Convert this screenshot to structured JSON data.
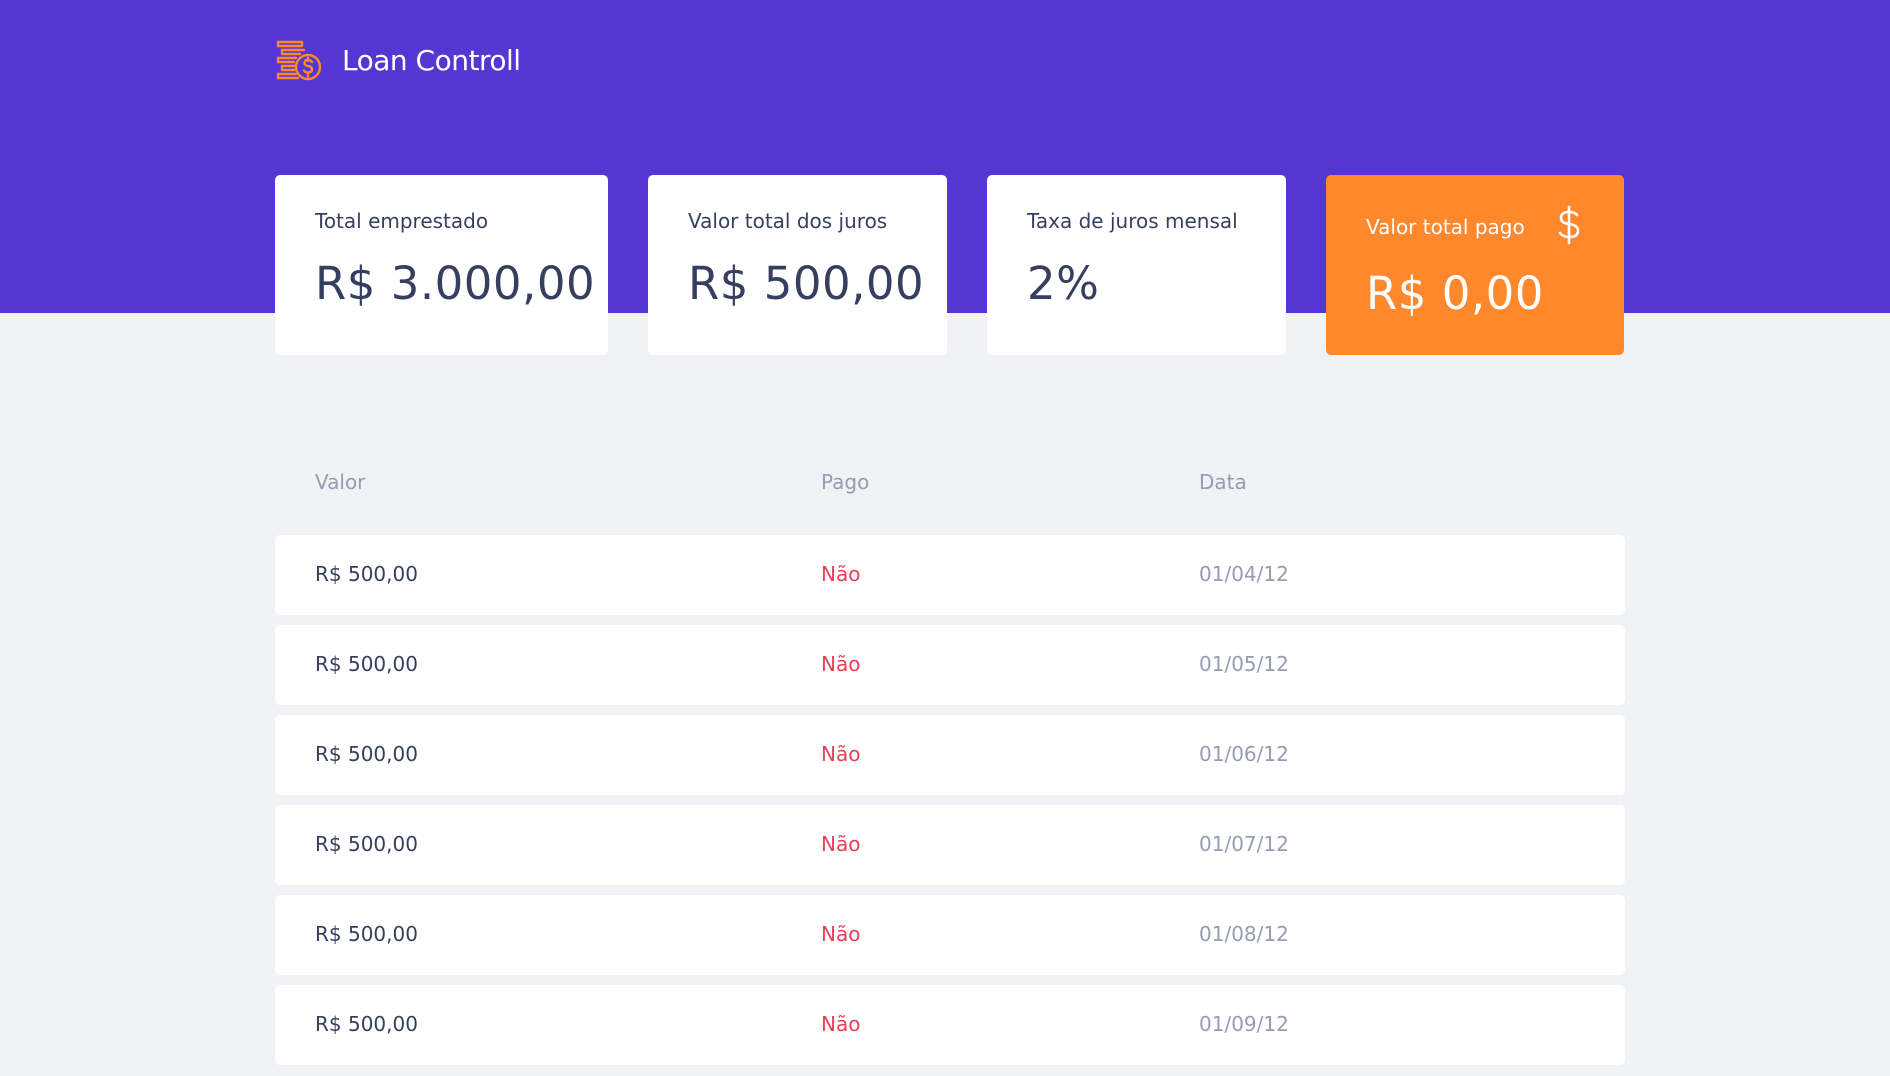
{
  "header": {
    "app_name": "Loan Controll",
    "logo_icon": "coins-dollar-icon"
  },
  "summary": {
    "total_lent": {
      "title": "Total emprestado",
      "value": "R$ 3.000,00"
    },
    "total_interest": {
      "title": "Valor total dos juros",
      "value": "R$ 500,00"
    },
    "monthly_rate": {
      "title": "Taxa de juros mensal",
      "value": "2%"
    },
    "total_paid": {
      "title": "Valor total pago",
      "value": "R$ 0,00",
      "icon": "dollar-sign-icon"
    }
  },
  "table": {
    "columns": [
      "Valor",
      "Pago",
      "Data"
    ],
    "rows": [
      {
        "valor": "R$ 500,00",
        "pago": "Não",
        "data": "01/04/12"
      },
      {
        "valor": "R$ 500,00",
        "pago": "Não",
        "data": "01/05/12"
      },
      {
        "valor": "R$ 500,00",
        "pago": "Não",
        "data": "01/06/12"
      },
      {
        "valor": "R$ 500,00",
        "pago": "Não",
        "data": "01/07/12"
      },
      {
        "valor": "R$ 500,00",
        "pago": "Não",
        "data": "01/08/12"
      },
      {
        "valor": "R$ 500,00",
        "pago": "Não",
        "data": "01/09/12"
      }
    ]
  },
  "colors": {
    "header_bg": "#5636d3",
    "page_bg": "#f0f2f5",
    "highlight_card": "#ff872c",
    "text_primary": "#363f5f",
    "text_muted": "#969cb3",
    "not_paid": "#e83f5b"
  }
}
